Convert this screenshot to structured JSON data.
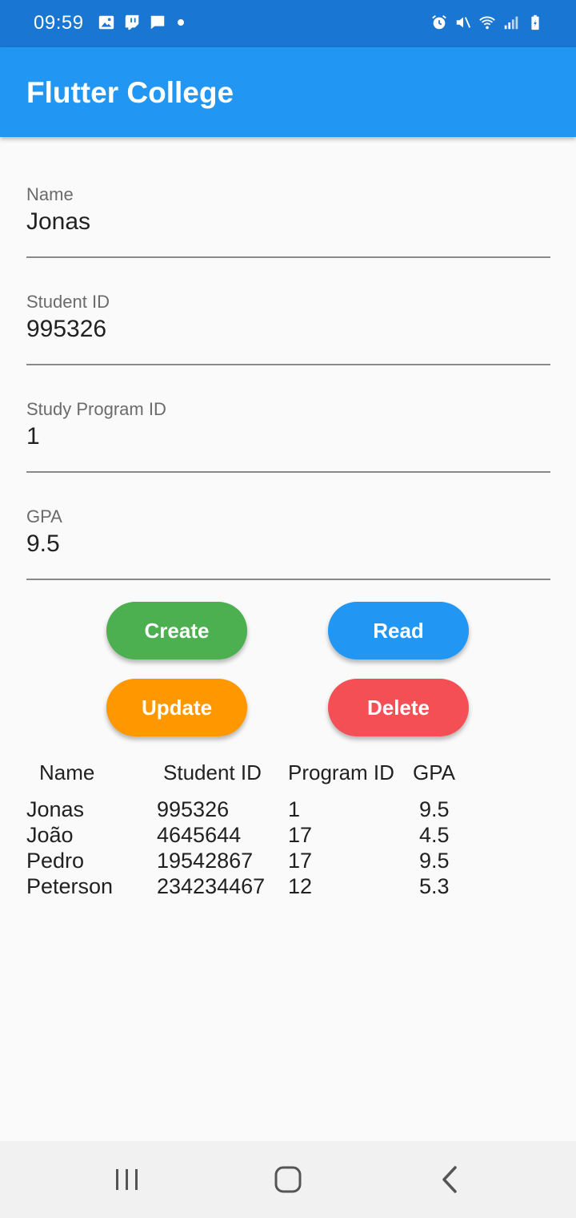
{
  "status_bar": {
    "time": "09:59",
    "left_icons": [
      "image-icon",
      "twitch-icon",
      "chat-icon",
      "dot-icon"
    ],
    "right_icons": [
      "alarm-icon",
      "mute-icon",
      "wifi-icon",
      "signal-icon",
      "battery-icon"
    ],
    "color": "#1976d2"
  },
  "app_bar": {
    "title": "Flutter College",
    "color": "#2196f3"
  },
  "form": {
    "name": {
      "label": "Name",
      "value": "Jonas"
    },
    "student_id": {
      "label": "Student ID",
      "value": "995326"
    },
    "program_id": {
      "label": "Study Program ID",
      "value": "1"
    },
    "gpa": {
      "label": "GPA",
      "value": "9.5"
    }
  },
  "buttons": {
    "create": {
      "label": "Create",
      "color": "#4caf50"
    },
    "read": {
      "label": "Read",
      "color": "#2196f3"
    },
    "update": {
      "label": "Update",
      "color": "#ff9800"
    },
    "delete": {
      "label": "Delete",
      "color": "#f44f55"
    }
  },
  "table": {
    "headers": [
      "Name",
      "Student ID",
      "Program ID",
      "GPA"
    ],
    "rows": [
      [
        "Jonas",
        "995326",
        "1",
        "9.5"
      ],
      [
        "João",
        "4645644",
        "17",
        "4.5"
      ],
      [
        "Pedro",
        "19542867",
        "17",
        "9.5"
      ],
      [
        "Peterson",
        "234234467",
        "12",
        "5.3"
      ]
    ]
  },
  "nav_bar": {
    "icons": [
      "recents-icon",
      "home-icon",
      "back-icon"
    ]
  }
}
